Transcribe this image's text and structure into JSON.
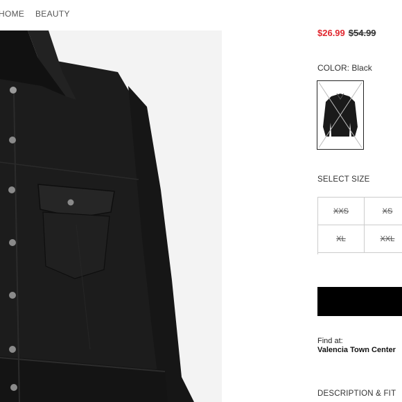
{
  "nav": {
    "items": [
      {
        "label": "HOME"
      },
      {
        "label": "BEAUTY"
      }
    ]
  },
  "product": {
    "price": {
      "sale": "$26.99",
      "original": "$54.99",
      "sale_color": "#e0262e"
    },
    "color": {
      "label": "COLOR:",
      "value": "Black"
    },
    "size": {
      "label": "SELECT SIZE",
      "options": [
        {
          "label": "XXS",
          "available": false
        },
        {
          "label": "XS",
          "available": false
        },
        {
          "label": "XL",
          "available": false
        },
        {
          "label": "XXL",
          "available": false
        }
      ]
    },
    "find": {
      "label": "Find at:",
      "store": "Valencia Town Center"
    },
    "description_title": "DESCRIPTION & FIT"
  },
  "icons": {
    "swatch_unavailable": "cross-out-icon"
  },
  "colors": {
    "cta_background": "#000000",
    "product_color": "#1a1a1a"
  }
}
